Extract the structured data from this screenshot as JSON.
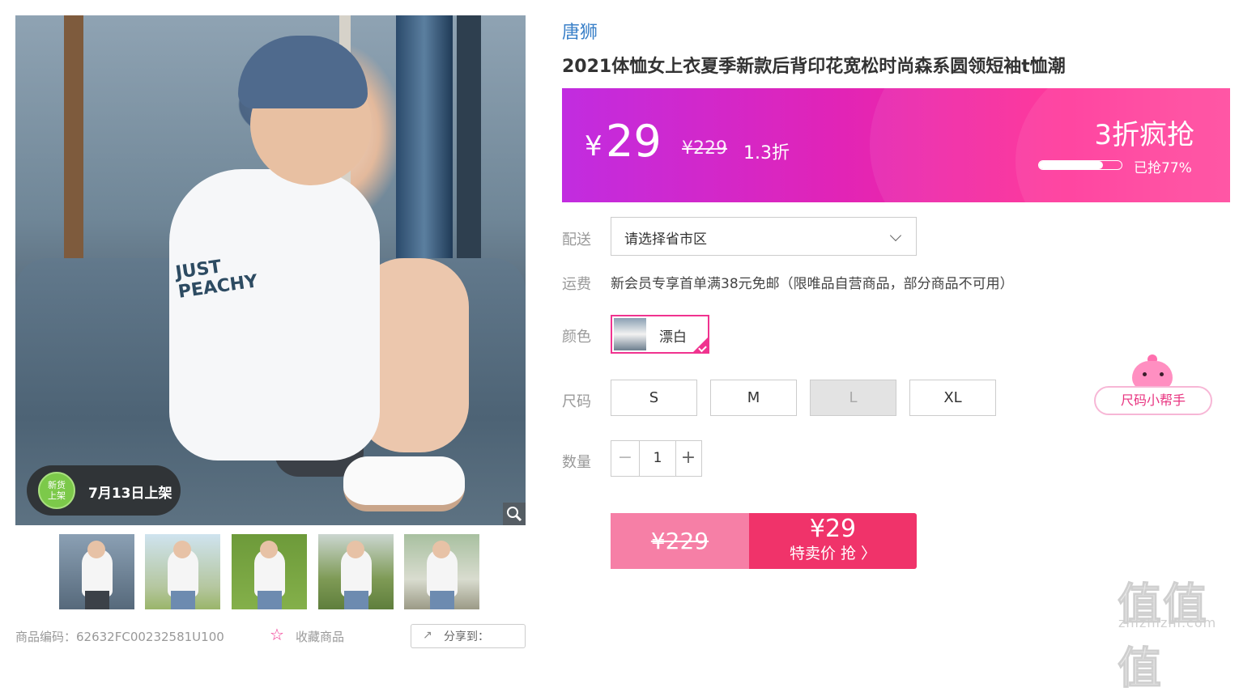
{
  "gallery": {
    "main_print_text": "JUST\nPEACHY",
    "new_badge": {
      "icon_text": "新货\n上架",
      "date_label": "7月13日上架"
    },
    "thumbnails": [
      "thumb-1",
      "thumb-2",
      "thumb-3",
      "thumb-4",
      "thumb-5"
    ],
    "product_code_label": "商品编码：62632FC00232581U100",
    "favorite_label": "收藏商品",
    "share_label": "分享到："
  },
  "product": {
    "brand": "唐狮",
    "title": "2021体恤女上衣夏季新款后背印花宽松时尚森系圆领短袖t恤潮"
  },
  "price_banner": {
    "currency": "¥",
    "price": "29",
    "original_price": "¥229",
    "discount": "1.3折",
    "flash_title": "3折疯抢",
    "progress": 0.77,
    "progress_label": "已抢77%",
    "colors": {
      "start": "#c12ce0",
      "end": "#ff3e98"
    }
  },
  "delivery": {
    "label": "配送",
    "placeholder": "请选择省市区"
  },
  "shipping": {
    "label": "运费",
    "text": "新会员专享首单满38元免邮（限唯品自营商品，部分商品不可用）"
  },
  "color": {
    "label": "颜色",
    "selected": "漂白",
    "accent": "#f0338f"
  },
  "size": {
    "label": "尺码",
    "options": [
      {
        "label": "S",
        "disabled": false
      },
      {
        "label": "M",
        "disabled": false
      },
      {
        "label": "L",
        "disabled": true
      },
      {
        "label": "XL",
        "disabled": false
      }
    ],
    "helper_label": "尺码小帮手"
  },
  "quantity": {
    "label": "数量",
    "minus": "−",
    "value": "1",
    "plus": "+"
  },
  "buy": {
    "original_price": "¥229",
    "price": "¥29",
    "cta": "特卖价 抢 〉"
  },
  "watermark": {
    "logo": "值值值",
    "url": "zhizhizhi.com"
  },
  "icons": {
    "zoom": "magnifier-icon",
    "chevron": "chevron-down-icon",
    "check": "check-icon",
    "star": "star-icon",
    "share": "share-icon"
  }
}
